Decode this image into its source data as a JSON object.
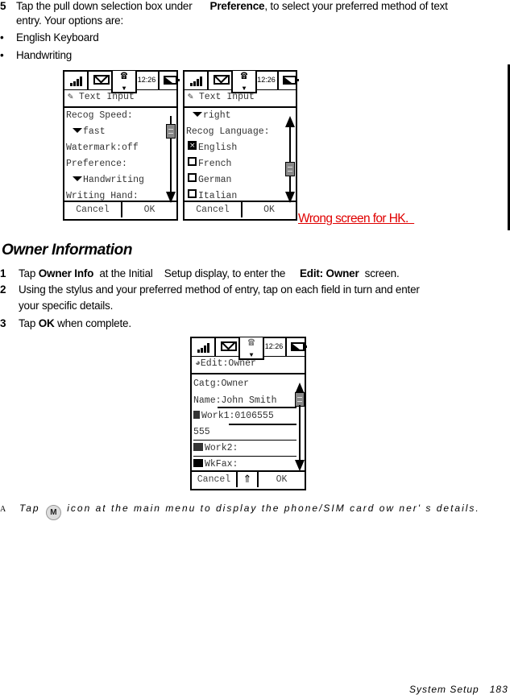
{
  "step5": {
    "number": "5",
    "text_before": "Tap the pull down selection box under",
    "bold": "Preference",
    "text_after": ", to select your preferred method of text",
    "line2": "entry. Your options are:"
  },
  "options": [
    {
      "bullet": "•",
      "label": "English Keyboard"
    },
    {
      "bullet": "•",
      "label": "Handwriting"
    }
  ],
  "screen1": {
    "time": "12:26",
    "title": "Text Input",
    "rows": [
      "Recog Speed:",
      "fast",
      "Watermark:off",
      "Preference:",
      "Handwriting",
      "Writing Hand:"
    ],
    "cancel": "Cancel",
    "ok": "OK"
  },
  "screen2": {
    "time": "12:26",
    "title": "Text Input",
    "rows": [
      "right",
      "Recog Language:"
    ],
    "languages": [
      {
        "label": "English",
        "checked": true
      },
      {
        "label": "French",
        "checked": false
      },
      {
        "label": "German",
        "checked": false
      },
      {
        "label": "Italian",
        "checked": false
      }
    ],
    "cancel": "Cancel",
    "ok": "OK"
  },
  "annotation": "Wrong screen for HK.  ",
  "section": {
    "title": "Owner Information",
    "steps": [
      {
        "number": "1",
        "t1": "Tap ",
        "b1": "Owner Info",
        "t2": "  at the Initial    Setup display, to enter the     ",
        "b2": "Edit: Owner",
        "t3": "  screen."
      },
      {
        "number": "2",
        "line1": "Using the stylus and your preferred method of entry, tap on each field in turn and enter",
        "line2": "your specific details."
      },
      {
        "number": "3",
        "t1": "Tap ",
        "b1": "OK",
        "t2": " when complete."
      }
    ]
  },
  "screen3": {
    "time": "12:26",
    "title": "Edit:Owner",
    "fields": [
      {
        "label": "Catg:Owner"
      },
      {
        "label": "Name:John Smith"
      },
      {
        "label": "Work1:0106555"
      },
      {
        "label": "555"
      },
      {
        "label": "Work2:"
      },
      {
        "label": "WkFax:"
      }
    ],
    "cancel": "Cancel",
    "ok": "OK"
  },
  "note": {
    "marker": "A",
    "before": "Tap",
    "icon": "M",
    "after": "icon at the main menu to display the phone/SIM card ow ner' s details."
  },
  "footer": {
    "section": "System Setup",
    "page": "183"
  }
}
